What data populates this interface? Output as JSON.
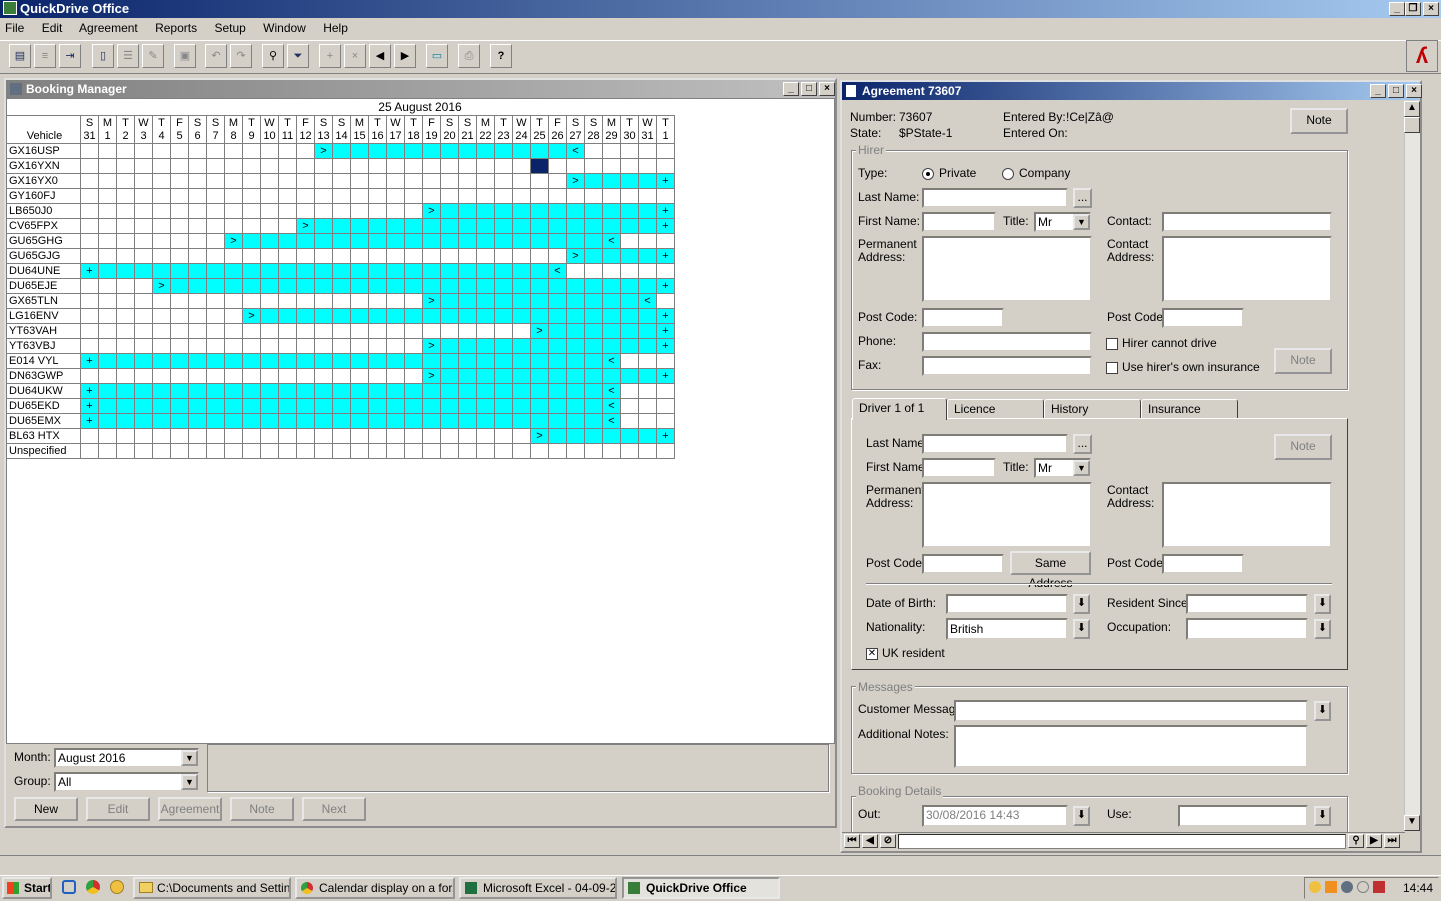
{
  "app": {
    "title": "QuickDrive Office"
  },
  "menu": [
    "File",
    "Edit",
    "Agreement",
    "Reports",
    "Setup",
    "Window",
    "Help"
  ],
  "toolbar_icons": [
    "new-doc-icon",
    "list-icon",
    "export-icon",
    "document-icon",
    "list-view-icon",
    "edit-doc-icon",
    "save-icon",
    "undo-icon",
    "redo-icon",
    "binoculars-icon",
    "filter-icon",
    "add-booking-icon",
    "remove-booking-icon",
    "prev-icon",
    "next-icon",
    "screen-icon",
    "print-icon",
    "help-icon"
  ],
  "booking": {
    "title": "Booking Manager",
    "date_header": "25 August 2016",
    "vehicle_header": "Vehicle",
    "days": [
      {
        "d": "S",
        "n": "31"
      },
      {
        "d": "M",
        "n": "1"
      },
      {
        "d": "T",
        "n": "2"
      },
      {
        "d": "W",
        "n": "3"
      },
      {
        "d": "T",
        "n": "4"
      },
      {
        "d": "F",
        "n": "5"
      },
      {
        "d": "S",
        "n": "6"
      },
      {
        "d": "S",
        "n": "7"
      },
      {
        "d": "M",
        "n": "8"
      },
      {
        "d": "T",
        "n": "9"
      },
      {
        "d": "W",
        "n": "10"
      },
      {
        "d": "T",
        "n": "11"
      },
      {
        "d": "F",
        "n": "12"
      },
      {
        "d": "S",
        "n": "13"
      },
      {
        "d": "S",
        "n": "14"
      },
      {
        "d": "M",
        "n": "15"
      },
      {
        "d": "T",
        "n": "16"
      },
      {
        "d": "W",
        "n": "17"
      },
      {
        "d": "T",
        "n": "18"
      },
      {
        "d": "F",
        "n": "19"
      },
      {
        "d": "S",
        "n": "20"
      },
      {
        "d": "S",
        "n": "21"
      },
      {
        "d": "M",
        "n": "22"
      },
      {
        "d": "T",
        "n": "23"
      },
      {
        "d": "W",
        "n": "24"
      },
      {
        "d": "T",
        "n": "25"
      },
      {
        "d": "F",
        "n": "26"
      },
      {
        "d": "S",
        "n": "27"
      },
      {
        "d": "S",
        "n": "28"
      },
      {
        "d": "M",
        "n": "29"
      },
      {
        "d": "T",
        "n": "30"
      },
      {
        "d": "W",
        "n": "31"
      },
      {
        "d": "T",
        "n": "1"
      }
    ],
    "rows": [
      {
        "v": "GX16USP",
        "s": 13,
        "e": 27,
        "sm": ">",
        "em": "<"
      },
      {
        "v": "GX16YXN",
        "sel": 25
      },
      {
        "v": "GX16YX0",
        "s": 27,
        "e": 32,
        "sm": ">",
        "em": "+"
      },
      {
        "v": "GY160FJ"
      },
      {
        "v": "LB650J0",
        "s": 19,
        "e": 32,
        "sm": ">",
        "em": "+"
      },
      {
        "v": "CV65FPX",
        "s": 12,
        "e": 32,
        "sm": ">",
        "em": "+"
      },
      {
        "v": "GU65GHG",
        "s": 8,
        "e": 29,
        "sm": ">",
        "em": "<"
      },
      {
        "v": "GU65GJG",
        "s": 27,
        "e": 32,
        "sm": ">",
        "em": "+"
      },
      {
        "v": "DU64UNE",
        "s": 0,
        "e": 26,
        "sm": "+",
        "em": "<"
      },
      {
        "v": "DU65EJE",
        "s": 4,
        "e": 32,
        "sm": ">",
        "em": "+"
      },
      {
        "v": "GX65TLN",
        "s": 19,
        "e": 31,
        "sm": ">",
        "em": "<"
      },
      {
        "v": "LG16ENV",
        "s": 9,
        "e": 32,
        "sm": ">",
        "em": "+"
      },
      {
        "v": "YT63VAH",
        "s": 25,
        "e": 32,
        "sm": ">",
        "em": "+"
      },
      {
        "v": "YT63VBJ",
        "s": 19,
        "e": 32,
        "sm": ">",
        "em": "+"
      },
      {
        "v": "E014 VYL",
        "s": 0,
        "e": 29,
        "sm": "+",
        "em": "<"
      },
      {
        "v": "DN63GWP",
        "s": 19,
        "e": 32,
        "sm": ">",
        "em": "+"
      },
      {
        "v": "DU64UKW",
        "s": 0,
        "e": 29,
        "sm": "+",
        "em": "<"
      },
      {
        "v": "DU65EKD",
        "s": 0,
        "e": 29,
        "sm": "+",
        "em": "<"
      },
      {
        "v": "DU65EMX",
        "s": 0,
        "e": 29,
        "sm": "+",
        "em": "<"
      },
      {
        "v": "BL63 HTX",
        "s": 25,
        "e": 32,
        "sm": ">",
        "em": "+"
      },
      {
        "v": "Unspecified"
      }
    ],
    "month_label": "Month:",
    "month_value": "August 2016",
    "group_label": "Group:",
    "group_value": "All",
    "buttons": {
      "new": "New",
      "edit": "Edit",
      "agreement": "Agreement",
      "note": "Note",
      "next": "Next"
    }
  },
  "agreement": {
    "title": "Agreement 73607",
    "number_label": "Number:",
    "number_value": "73607",
    "state_label": "State:",
    "state_value": "$PState-1",
    "entered_by_label": "Entered By:",
    "entered_by_value": "!Ce|Zâ@",
    "entered_on_label": "Entered On:",
    "note_button": "Note",
    "hirer": {
      "group": "Hirer",
      "type_label": "Type:",
      "private": "Private",
      "company": "Company",
      "last_name": "Last Name:",
      "first_name": "First Name:",
      "title_label": "Title:",
      "title_value": "Mr",
      "contact": "Contact:",
      "perm_address": "Permanent Address:",
      "contact_address": "Contact Address:",
      "post_code": "Post Code:",
      "phone": "Phone:",
      "fax": "Fax:",
      "cannot_drive": "Hirer cannot drive",
      "own_insurance": "Use hirer's own insurance",
      "note": "Note",
      "ellipsis": "..."
    },
    "tabs": [
      "Driver 1 of 1",
      "Licence",
      "History",
      "Insurance"
    ],
    "driver": {
      "last_name": "Last Name:",
      "first_name": "First Name:",
      "title_label": "Title:",
      "title_value": "Mr",
      "perm_address": "Permanent Address:",
      "contact_address": "Contact Address:",
      "post_code": "Post Code:",
      "same_address": "Same Address",
      "note": "Note",
      "dob": "Date of Birth:",
      "resident_since": "Resident Since:",
      "nationality": "Nationality:",
      "nationality_value": "British",
      "occupation": "Occupation:",
      "uk_resident": "UK resident",
      "ellipsis": "..."
    },
    "messages": {
      "group": "Messages",
      "customer": "Customer Message:",
      "notes": "Additional Notes:"
    },
    "booking_details": {
      "group": "Booking Details",
      "out": "Out:",
      "out_value": "30/08/2016 14:43",
      "use": "Use:"
    }
  },
  "taskbar": {
    "start": "Start",
    "items": [
      "C:\\Documents and Settin...",
      "Calendar display on a for...",
      "Microsoft Excel - 04-09-2...",
      "QuickDrive Office"
    ],
    "time": "14:44"
  }
}
